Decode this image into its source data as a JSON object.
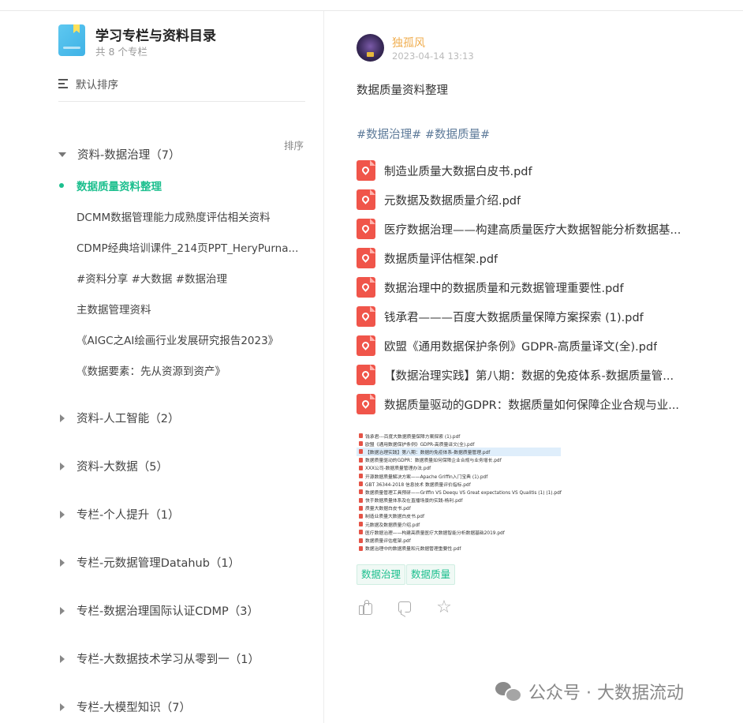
{
  "catalog": {
    "title": "学习专栏与资料目录",
    "count": "共 8 个专栏",
    "sort_label": "默认排序",
    "expanded_group": {
      "label": "资料-数据治理（7）",
      "sort_action": "排序",
      "articles": [
        "数据质量资料整理",
        "DCMM数据管理能力成熟度评估相关资料",
        "CDMP经典培训课件_214页PPT_HeryPurna...",
        "#资料分享 #大数据 #数据治理",
        "主数据管理资料",
        "《AIGC之AI绘画行业发展研究报告2023》",
        "《数据要素：先从资源到资产》"
      ]
    },
    "collapsed_groups": [
      "资料-人工智能（2）",
      "资料-大数据（5）",
      "专栏-个人提升（1）",
      "专栏-元数据管理Datahub（1）",
      "专栏-数据治理国际认证CDMP（3）",
      "专栏-大数据技术学习从零到一（1）",
      "专栏-大模型知识（7）"
    ]
  },
  "post": {
    "author": "独孤风",
    "date": "2023-04-14 13:13",
    "title": "数据质量资料整理",
    "hashtags": "#数据治理# #数据质量#",
    "files": [
      "制造业质量大数据白皮书.pdf",
      "元数据及数据质量介绍.pdf",
      "医疗数据治理——构建高质量医疗大数据智能分析数据基...",
      "数据质量评估框架.pdf",
      "数据治理中的数据质量和元数据管理重要性.pdf",
      "钱承君———百度大数据质量保障方案探索 (1).pdf",
      "欧盟《通用数据保护条例》GDPR-高质量译文(全).pdf",
      "【数据治理实践】第八期：数据的免疫体系-数据质量管...",
      "数据质量驱动的GDPR：数据质量如何保障企业合规与业..."
    ],
    "screenshot_rows": [
      "钱承君---百度大数据质量保障方案探索 (1).pdf",
      "欧盟《通用数据保护条例》GDPR-高质量译文(全).pdf",
      "【数据治理实践】第八期：数据的免疫体系-数据质量管理.pdf",
      "数据质量驱动的GDPR：数据质量如何保障企业合规与业务增长.pdf",
      "XXX公司-数据质量管理办法.pdf",
      "开源数据质量解决方案——Apache Griffin入门宝典 (1).pdf",
      "GBT 36344-2018 信息技术 数据质量评价指标.pdf",
      "数据质量管理工具预研——Griffin VS Deequ VS Great expectations VS  Qualitis (1) (1).pdf",
      "快手数据质量体系及在直播场景的实践-杨利.pdf",
      "质量大数据白皮书.pdf",
      "制造业质量大数据白皮书.pdf",
      "元数据及数据质量介绍.pdf",
      "医疗数据治理——构建高质量医疗大数据智能分析数据基础2019.pdf",
      "数据质量评估框架.pdf",
      "数据治理中的数据质量和元数据管理重要性.pdf"
    ],
    "tags": [
      "数据治理",
      "数据质量"
    ],
    "actions": [
      "like-icon",
      "comment-icon",
      "star-icon"
    ]
  },
  "watermark": "公众号 · 大数据流动",
  "colors": {
    "accent_green": "#1cbf8e",
    "author_orange": "#f0ad4e",
    "pdf_red": "#f0554a",
    "hashtag_blue": "#5d7a99"
  }
}
